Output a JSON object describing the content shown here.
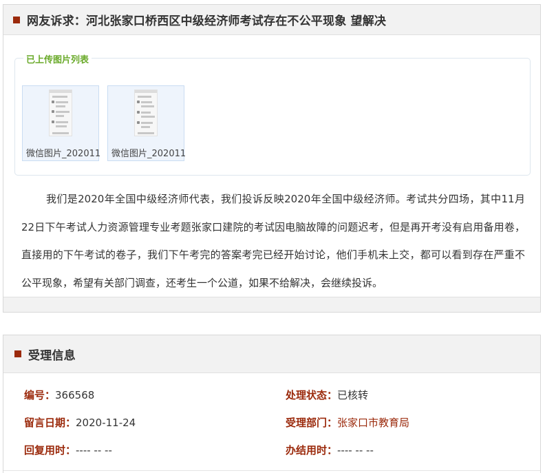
{
  "complaint": {
    "square_icon_color": "#9b2a0c",
    "title": "网友诉求：河北张家口桥西区中级经济师考试存在不公平现象 望解决",
    "uploads": {
      "legend": "已上传图片列表",
      "items": [
        {
          "caption": "微信图片_202011"
        },
        {
          "caption": "微信图片_202011"
        }
      ]
    },
    "body": "我们是2020年全国中级经济师代表，我们投诉反映2020年全国中级经济师。考试共分四场，其中11月22日下午考试人力资源管理专业考题张家口建院的考试因电脑故障的问题迟考，但是再开考没有启用备用卷，直接用的下午考试的卷子，我们下午考完的答案考完已经开始讨论，他们手机未上交，都可以看到存在严重不公平现象，希望有关部门调查，还考生一个公道，如果不给解决，会继续投诉。"
  },
  "info": {
    "title": "受理信息",
    "fields": {
      "number": {
        "label": "编号：",
        "value": "366568"
      },
      "status": {
        "label": "处理状态：",
        "value": "已核转"
      },
      "date": {
        "label": "留言日期：",
        "value": "2020-11-24"
      },
      "department": {
        "label": "受理部门：",
        "value": "张家口市教育局"
      },
      "reply_time": {
        "label": "回复用时：",
        "value": "---- -- --"
      },
      "finish_time": {
        "label": "办结用时：",
        "value": "---- -- --"
      }
    }
  }
}
